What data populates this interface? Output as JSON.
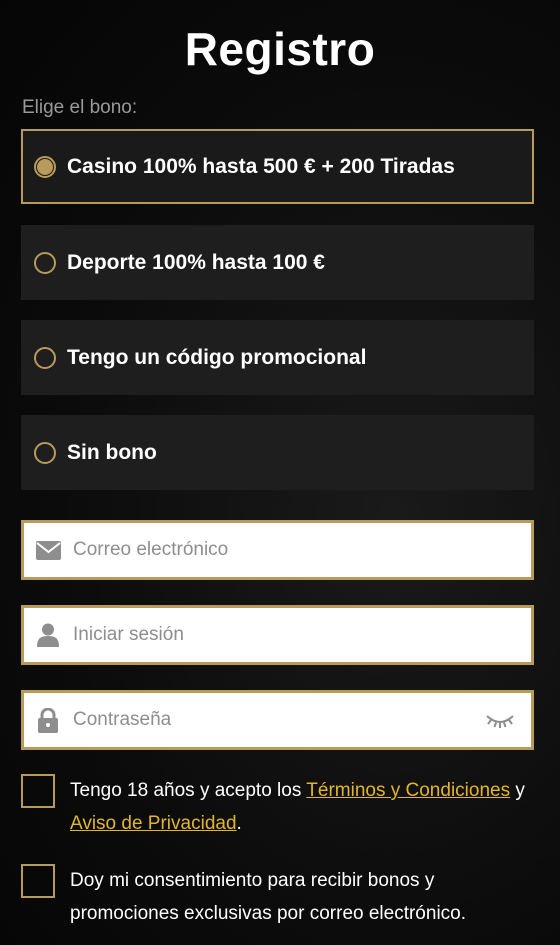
{
  "page": {
    "title": "Registro",
    "bonus_label": "Elige el bono:"
  },
  "bonus_options": [
    {
      "label": "Casino 100% hasta 500 € + 200 Tiradas",
      "selected": true
    },
    {
      "label": "Deporte 100% hasta 100 €",
      "selected": false
    },
    {
      "label": "Tengo un código promocional",
      "selected": false
    },
    {
      "label": "Sin bono",
      "selected": false
    }
  ],
  "form": {
    "email": {
      "placeholder": "Correo electrónico",
      "value": "",
      "icon": "envelope-icon"
    },
    "login": {
      "placeholder": "Iniciar sesión",
      "value": "",
      "icon": "user-icon"
    },
    "password": {
      "placeholder": "Contraseña",
      "value": "",
      "icon": "lock-icon",
      "toggle_icon": "eye-closed-icon"
    }
  },
  "consents": {
    "age": {
      "text_before": "Tengo 18 años y acepto los ",
      "terms_link": "Términos y Condiciones",
      "text_mid": " y",
      "privacy_link": "Aviso de Privacidad",
      "text_after": "."
    },
    "marketing": {
      "text": "Doy mi consentimiento para recibir bonos y promociones exclusivas por correo electrónico."
    }
  },
  "colors": {
    "accent": "#b89a5a",
    "link": "#e3b62a",
    "option_bg": "#1e1e1e"
  }
}
